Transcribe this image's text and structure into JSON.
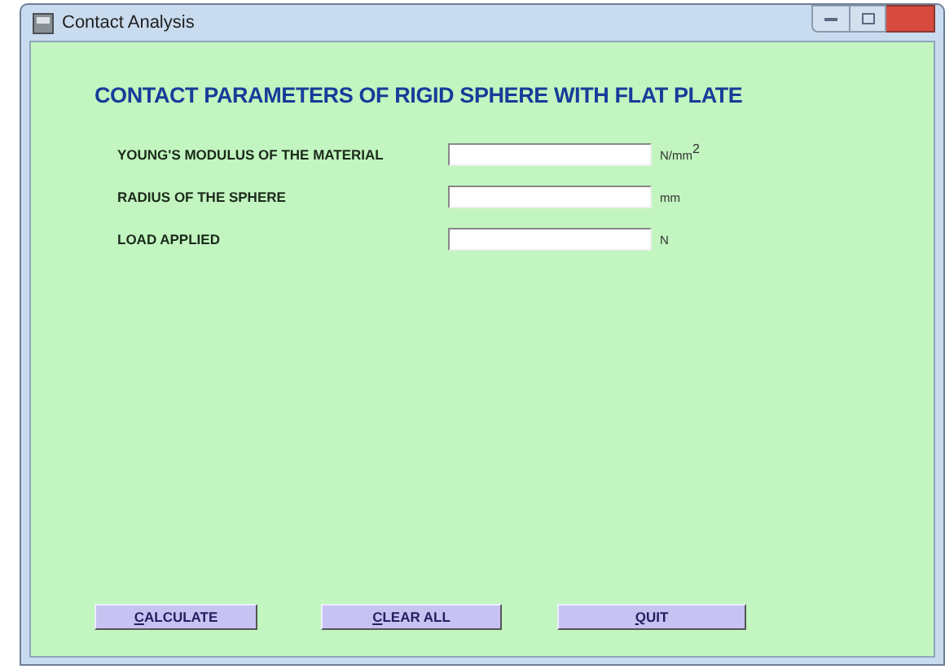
{
  "window": {
    "title": "Contact Analysis"
  },
  "heading": "CONTACT PARAMETERS OF RIGID SPHERE WITH FLAT PLATE",
  "fields": [
    {
      "label": "YOUNG'S MODULUS OF THE MATERIAL",
      "unit": "N/mm$^{2}$"
    },
    {
      "label": "RADIUS OF THE SPHERE",
      "unit": "mm"
    },
    {
      "label": "LOAD APPLIED",
      "unit": "N"
    }
  ],
  "buttons": [
    {
      "label": "CALCULATE",
      "access_key_underlined": true
    },
    {
      "label": "CLEAR ALL",
      "access_key_underlined": true
    },
    {
      "label": "QUIT",
      "access_key_underlined": true
    }
  ]
}
